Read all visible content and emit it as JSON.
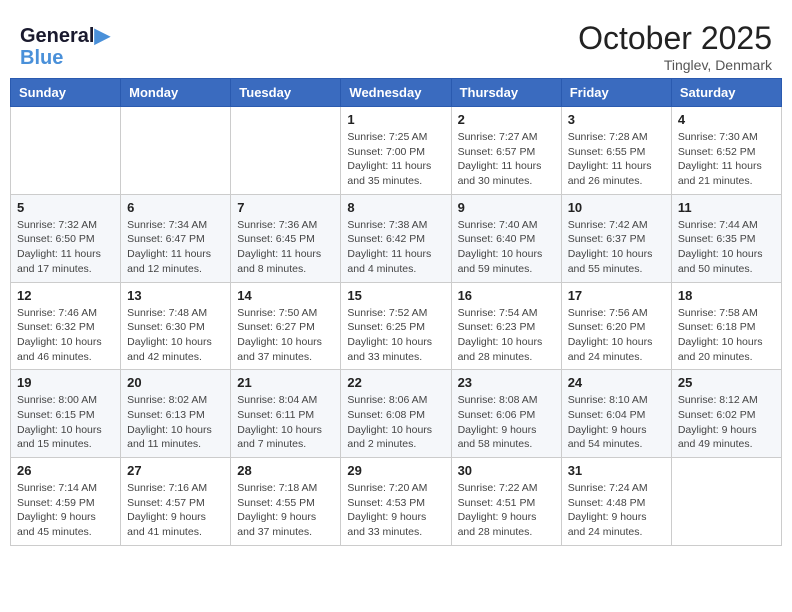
{
  "header": {
    "logo_line1": "General",
    "logo_line2": "Blue",
    "month": "October 2025",
    "location": "Tinglev, Denmark"
  },
  "days_of_week": [
    "Sunday",
    "Monday",
    "Tuesday",
    "Wednesday",
    "Thursday",
    "Friday",
    "Saturday"
  ],
  "weeks": [
    [
      {
        "day": "",
        "info": ""
      },
      {
        "day": "",
        "info": ""
      },
      {
        "day": "",
        "info": ""
      },
      {
        "day": "1",
        "info": "Sunrise: 7:25 AM\nSunset: 7:00 PM\nDaylight: 11 hours\nand 35 minutes."
      },
      {
        "day": "2",
        "info": "Sunrise: 7:27 AM\nSunset: 6:57 PM\nDaylight: 11 hours\nand 30 minutes."
      },
      {
        "day": "3",
        "info": "Sunrise: 7:28 AM\nSunset: 6:55 PM\nDaylight: 11 hours\nand 26 minutes."
      },
      {
        "day": "4",
        "info": "Sunrise: 7:30 AM\nSunset: 6:52 PM\nDaylight: 11 hours\nand 21 minutes."
      }
    ],
    [
      {
        "day": "5",
        "info": "Sunrise: 7:32 AM\nSunset: 6:50 PM\nDaylight: 11 hours\nand 17 minutes."
      },
      {
        "day": "6",
        "info": "Sunrise: 7:34 AM\nSunset: 6:47 PM\nDaylight: 11 hours\nand 12 minutes."
      },
      {
        "day": "7",
        "info": "Sunrise: 7:36 AM\nSunset: 6:45 PM\nDaylight: 11 hours\nand 8 minutes."
      },
      {
        "day": "8",
        "info": "Sunrise: 7:38 AM\nSunset: 6:42 PM\nDaylight: 11 hours\nand 4 minutes."
      },
      {
        "day": "9",
        "info": "Sunrise: 7:40 AM\nSunset: 6:40 PM\nDaylight: 10 hours\nand 59 minutes."
      },
      {
        "day": "10",
        "info": "Sunrise: 7:42 AM\nSunset: 6:37 PM\nDaylight: 10 hours\nand 55 minutes."
      },
      {
        "day": "11",
        "info": "Sunrise: 7:44 AM\nSunset: 6:35 PM\nDaylight: 10 hours\nand 50 minutes."
      }
    ],
    [
      {
        "day": "12",
        "info": "Sunrise: 7:46 AM\nSunset: 6:32 PM\nDaylight: 10 hours\nand 46 minutes."
      },
      {
        "day": "13",
        "info": "Sunrise: 7:48 AM\nSunset: 6:30 PM\nDaylight: 10 hours\nand 42 minutes."
      },
      {
        "day": "14",
        "info": "Sunrise: 7:50 AM\nSunset: 6:27 PM\nDaylight: 10 hours\nand 37 minutes."
      },
      {
        "day": "15",
        "info": "Sunrise: 7:52 AM\nSunset: 6:25 PM\nDaylight: 10 hours\nand 33 minutes."
      },
      {
        "day": "16",
        "info": "Sunrise: 7:54 AM\nSunset: 6:23 PM\nDaylight: 10 hours\nand 28 minutes."
      },
      {
        "day": "17",
        "info": "Sunrise: 7:56 AM\nSunset: 6:20 PM\nDaylight: 10 hours\nand 24 minutes."
      },
      {
        "day": "18",
        "info": "Sunrise: 7:58 AM\nSunset: 6:18 PM\nDaylight: 10 hours\nand 20 minutes."
      }
    ],
    [
      {
        "day": "19",
        "info": "Sunrise: 8:00 AM\nSunset: 6:15 PM\nDaylight: 10 hours\nand 15 minutes."
      },
      {
        "day": "20",
        "info": "Sunrise: 8:02 AM\nSunset: 6:13 PM\nDaylight: 10 hours\nand 11 minutes."
      },
      {
        "day": "21",
        "info": "Sunrise: 8:04 AM\nSunset: 6:11 PM\nDaylight: 10 hours\nand 7 minutes."
      },
      {
        "day": "22",
        "info": "Sunrise: 8:06 AM\nSunset: 6:08 PM\nDaylight: 10 hours\nand 2 minutes."
      },
      {
        "day": "23",
        "info": "Sunrise: 8:08 AM\nSunset: 6:06 PM\nDaylight: 9 hours\nand 58 minutes."
      },
      {
        "day": "24",
        "info": "Sunrise: 8:10 AM\nSunset: 6:04 PM\nDaylight: 9 hours\nand 54 minutes."
      },
      {
        "day": "25",
        "info": "Sunrise: 8:12 AM\nSunset: 6:02 PM\nDaylight: 9 hours\nand 49 minutes."
      }
    ],
    [
      {
        "day": "26",
        "info": "Sunrise: 7:14 AM\nSunset: 4:59 PM\nDaylight: 9 hours\nand 45 minutes."
      },
      {
        "day": "27",
        "info": "Sunrise: 7:16 AM\nSunset: 4:57 PM\nDaylight: 9 hours\nand 41 minutes."
      },
      {
        "day": "28",
        "info": "Sunrise: 7:18 AM\nSunset: 4:55 PM\nDaylight: 9 hours\nand 37 minutes."
      },
      {
        "day": "29",
        "info": "Sunrise: 7:20 AM\nSunset: 4:53 PM\nDaylight: 9 hours\nand 33 minutes."
      },
      {
        "day": "30",
        "info": "Sunrise: 7:22 AM\nSunset: 4:51 PM\nDaylight: 9 hours\nand 28 minutes."
      },
      {
        "day": "31",
        "info": "Sunrise: 7:24 AM\nSunset: 4:48 PM\nDaylight: 9 hours\nand 24 minutes."
      },
      {
        "day": "",
        "info": ""
      }
    ]
  ]
}
